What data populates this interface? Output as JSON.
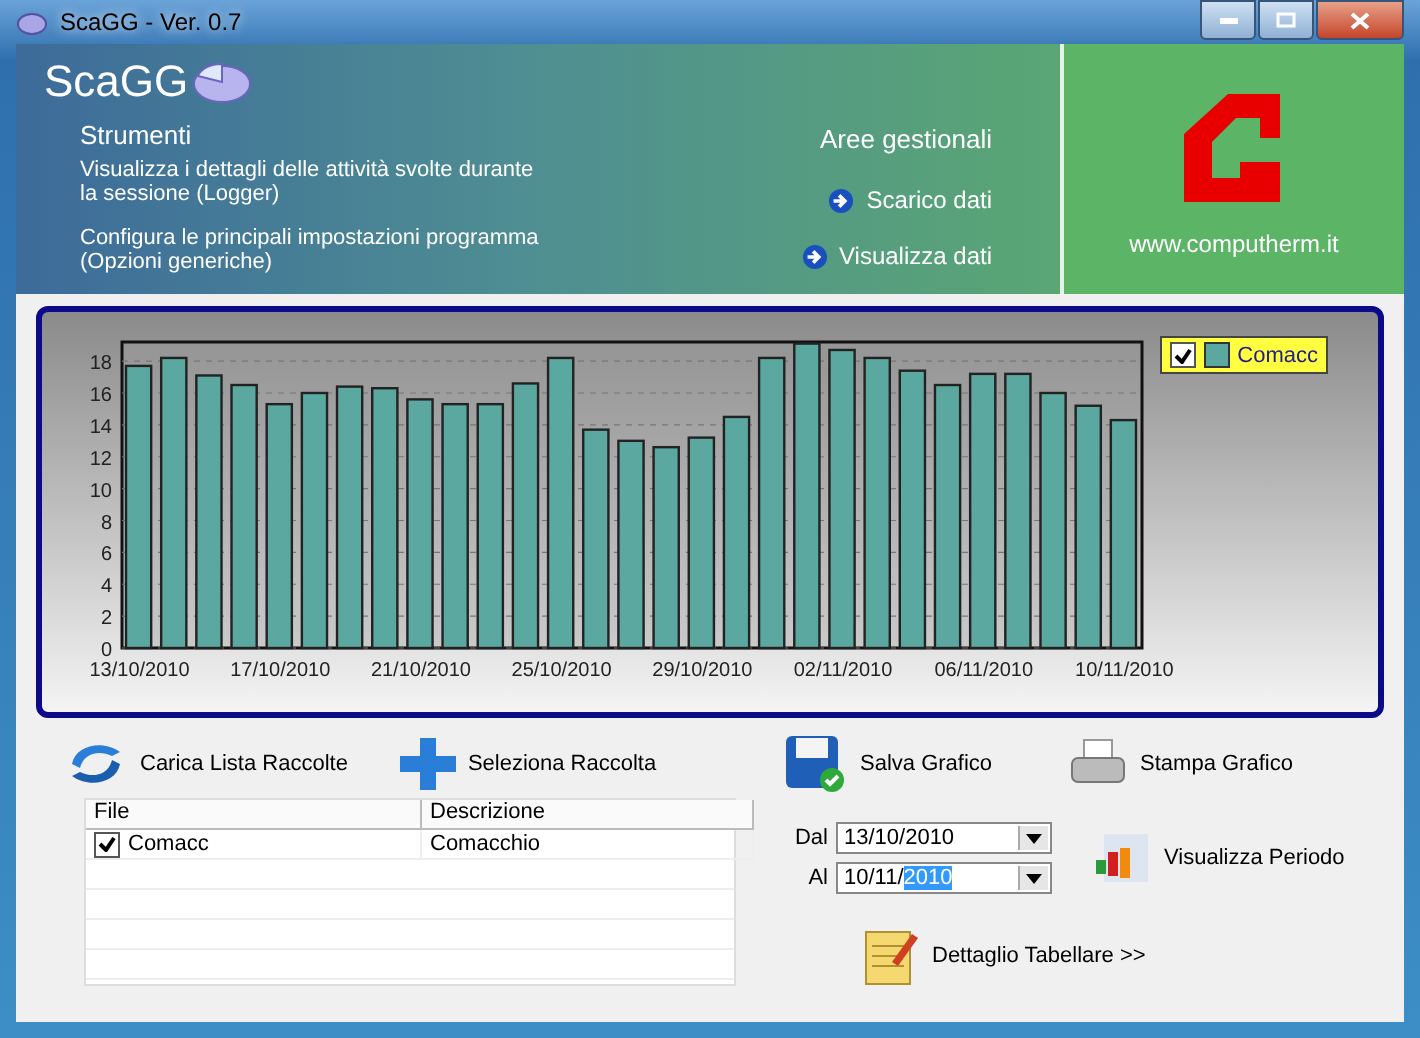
{
  "window": {
    "title": "ScaGG - Ver. 0.7"
  },
  "header": {
    "app_name": "ScaGG",
    "section": "Strumenti",
    "links": [
      "Visualizza i dettagli delle attività svolte durante la sessione (Logger)",
      "Configura le principali impostazioni programma (Opzioni generiche)"
    ],
    "areas_title": "Aree gestionali",
    "areas": [
      "Scarico dati",
      "Visualizza dati"
    ],
    "website": "www.computherm.it"
  },
  "chart": {
    "legend": {
      "checked": true
    },
    "chart_data": {
      "type": "bar",
      "grid": true,
      "categories": [
        "13/10/2010",
        null,
        null,
        null,
        "17/10/2010",
        null,
        null,
        null,
        "21/10/2010",
        null,
        null,
        null,
        "25/10/2010",
        null,
        null,
        null,
        "29/10/2010",
        null,
        null,
        null,
        "02/11/2010",
        null,
        null,
        null,
        "06/11/2010",
        null,
        null,
        null,
        "10/11/2010"
      ],
      "series": [
        {
          "name": "Comacc",
          "color": "#5ba8a0",
          "values": [
            17.7,
            18.2,
            17.1,
            16.5,
            15.3,
            16.0,
            16.4,
            16.3,
            15.6,
            15.3,
            15.3,
            16.6,
            18.2,
            13.7,
            13.0,
            12.6,
            13.2,
            14.5,
            18.2,
            19.1,
            18.7,
            18.2,
            17.4,
            16.5,
            17.2,
            17.2,
            16.0,
            15.2,
            14.3
          ]
        }
      ],
      "ylim": [
        0,
        19.2
      ],
      "yticks": [
        0,
        2,
        4,
        6,
        8,
        10,
        12,
        14,
        16,
        18
      ]
    }
  },
  "toolbar": [
    "Carica Lista Raccolte",
    "Seleziona Raccolta",
    "Salva Grafico",
    "Stampa Grafico"
  ],
  "table": {
    "columns": [
      "File",
      "Descrizione"
    ],
    "rows": [
      {
        "file": "Comacc",
        "description": "Comacchio",
        "checked": true
      }
    ]
  },
  "period": {
    "from": {
      "label": "Dal",
      "value": "13/10/2010"
    },
    "to": {
      "label": "Al",
      "value": "10/11/",
      "selection": "2010"
    },
    "show_button": "Visualizza Periodo"
  },
  "details_button": "Dettaglio Tabellare >>"
}
